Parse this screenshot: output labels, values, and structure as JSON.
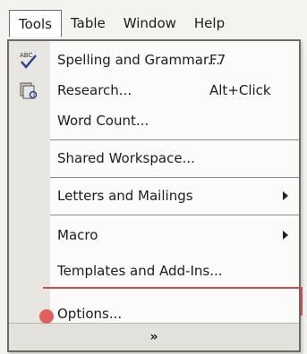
{
  "menubar": {
    "items": [
      {
        "label": "Tools"
      },
      {
        "label": "Table"
      },
      {
        "label": "Window"
      },
      {
        "label": "Help"
      }
    ]
  },
  "tools_menu": {
    "items": [
      {
        "label": "Spelling and Grammar...",
        "shortcut": "F7",
        "icon": "spelling-abc-check-icon"
      },
      {
        "label": "Research...",
        "shortcut": "Alt+Click",
        "icon": "research-book-icon"
      },
      {
        "label": "Word Count..."
      },
      {
        "label": "Shared Workspace..."
      },
      {
        "label": "Letters and Mailings",
        "submenu": true
      },
      {
        "label": "Macro",
        "submenu": true
      },
      {
        "label": "Templates and Add-Ins..."
      },
      {
        "label": "Options..."
      }
    ],
    "expand_glyph": "»",
    "colors": {
      "highlight": "#d84a4a"
    }
  }
}
